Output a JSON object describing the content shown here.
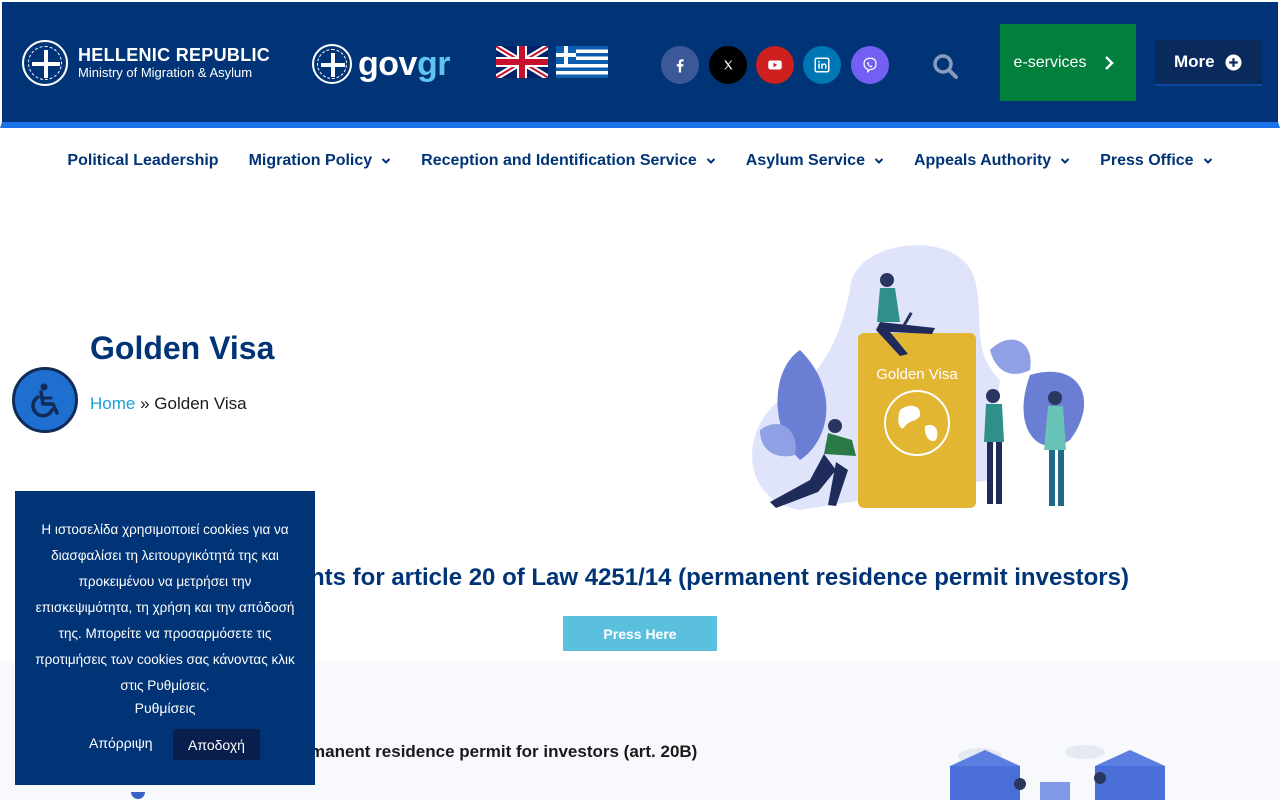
{
  "header": {
    "logo": {
      "line1": "HELLENIC REPUBLIC",
      "line2": "Ministry of Migration & Asylum"
    },
    "govgr": {
      "gov": "gov",
      "gr": "gr"
    },
    "languages": [
      "English",
      "Ελληνικά"
    ],
    "social_icons": [
      "facebook-icon",
      "x-icon",
      "youtube-icon",
      "linkedin-icon",
      "viber-icon"
    ],
    "eservices_label": "e-services",
    "more_label": "More"
  },
  "nav": {
    "items": [
      {
        "label": "Political Leadership",
        "has_dropdown": false
      },
      {
        "label": "Migration Policy",
        "has_dropdown": true
      },
      {
        "label": "Reception and Identification Service",
        "has_dropdown": true
      },
      {
        "label": "Asylum Service",
        "has_dropdown": true
      },
      {
        "label": "Appeals Authority",
        "has_dropdown": true
      },
      {
        "label": "Press Office",
        "has_dropdown": true
      }
    ]
  },
  "hero": {
    "title": "Golden Visa",
    "breadcrumb": {
      "home": "Home",
      "separator": "»",
      "current": "Golden Visa"
    },
    "illustration_label": "Golden Visa"
  },
  "content": {
    "doc_heading_visible": "nts for article 20 of Law 4251/14 (permanent residence permit investors)",
    "press_button": "Press Here",
    "sub_heading_visible": "manent residence permit for investors (art. 20B)"
  },
  "cookie": {
    "message": "Η ιστοσελίδα χρησιμοποιεί cookies για να διασφαλίσει τη λειτουργικότητά της και προκειμένου να μετρήσει την επισκεψιμότητα, τη χρήση και την απόδοσή της. Μπορείτε να προσαρμόσετε τις προτιμήσεις των cookies σας κάνοντας κλικ στις Ρυθμίσεις.",
    "settings": "Ρυθμίσεις",
    "reject": "Απόρριψη",
    "accept": "Αποδοχή"
  },
  "colors": {
    "header_bg": "#003476",
    "accent_blue": "#1a73e8",
    "eservices_green": "#007f3d",
    "press_button": "#5bc0de",
    "title_blue": "#003476"
  }
}
